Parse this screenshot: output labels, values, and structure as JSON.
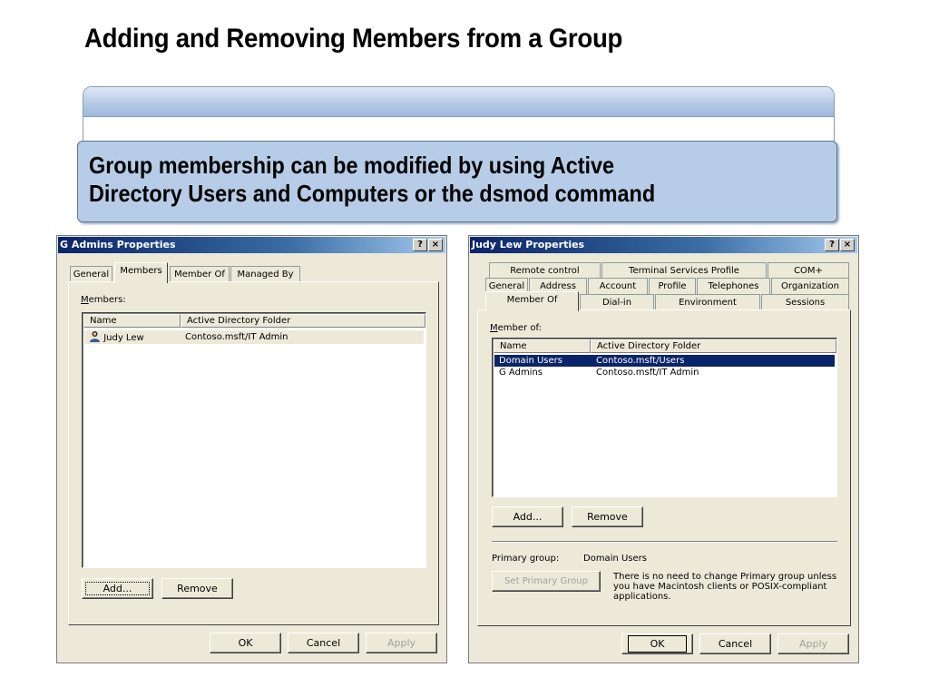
{
  "slide": {
    "title": "Adding and Removing Members from a Group",
    "callout_line1": "Group membership can be modified by using Active",
    "callout_line2": "Directory Users and Computers or the dsmod command"
  },
  "left_dialog": {
    "title": "G Admins Properties",
    "help_btn": "?",
    "close_btn": "×",
    "tabs": [
      "General",
      "Members",
      "Member Of",
      "Managed By"
    ],
    "active_tab": "Members",
    "members_label": "Members:",
    "columns": [
      "Name",
      "Active Directory Folder"
    ],
    "rows": [
      {
        "name": "Judy Lew",
        "folder": "Contoso.msft/IT Admin",
        "icon": "user-icon"
      }
    ],
    "add_label": "Add...",
    "remove_label": "Remove",
    "ok_label": "OK",
    "cancel_label": "Cancel",
    "apply_label": "Apply"
  },
  "right_dialog": {
    "title": "Judy Lew Properties",
    "help_btn": "?",
    "close_btn": "×",
    "tabs_row1": [
      "Remote control",
      "Terminal Services Profile",
      "COM+"
    ],
    "tabs_row2": [
      "General",
      "Address",
      "Account",
      "Profile",
      "Telephones",
      "Organization"
    ],
    "tabs_row3": [
      "Member Of",
      "Dial-in",
      "Environment",
      "Sessions"
    ],
    "active_tab": "Member Of",
    "member_of_label": "Member of:",
    "columns": [
      "Name",
      "Active Directory Folder"
    ],
    "rows": [
      {
        "name": "Domain Users",
        "folder": "Contoso.msft/Users",
        "selected": true
      },
      {
        "name": "G Admins",
        "folder": "Contoso.msft/IT Admin",
        "selected": false
      }
    ],
    "add_label": "Add...",
    "remove_label": "Remove",
    "primary_group_label": "Primary group:",
    "primary_group_value": "Domain Users",
    "set_primary_label": "Set Primary Group",
    "primary_note": "There is no need to change Primary group unless you have Macintosh clients or POSIX-compliant applications.",
    "ok_label": "OK",
    "cancel_label": "Cancel",
    "apply_label": "Apply"
  },
  "colors": {
    "callout_bg": "#b7cde7",
    "titlebar_start": "#0a246a",
    "selection": "#0a246a",
    "dialog_bg": "#ece9d8"
  }
}
